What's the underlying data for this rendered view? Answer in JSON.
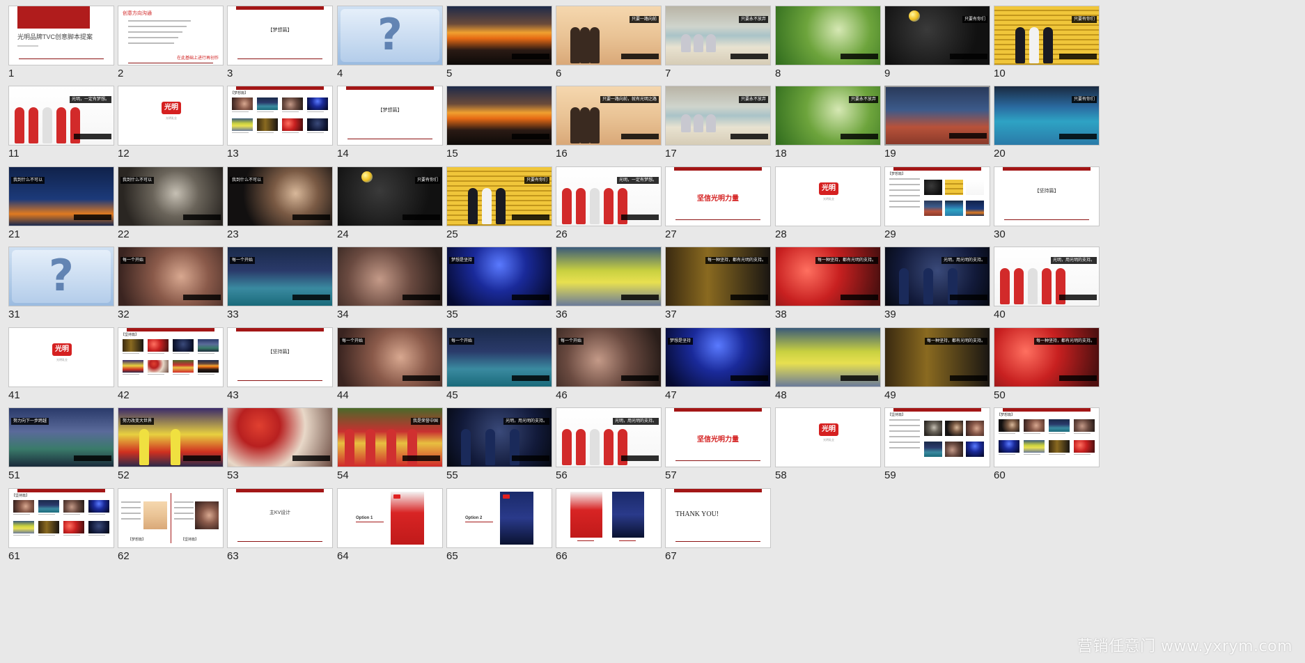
{
  "watermark": "营销任意门 www.yxrym.com",
  "colors": {
    "brand_red": "#d52020",
    "dark_red": "#a31616",
    "background": "#e8e8e8"
  },
  "slides": [
    {
      "num": "1",
      "kind": "title",
      "title": "光明品牌TVC创意脚本提案"
    },
    {
      "num": "2",
      "kind": "text-list",
      "heading": "创意方向沟通",
      "footer": "在此基础上进行再创作"
    },
    {
      "num": "3",
      "kind": "section",
      "label": "【梦想篇】"
    },
    {
      "num": "4",
      "kind": "video-missing"
    },
    {
      "num": "5",
      "kind": "photo",
      "scene": "sunset"
    },
    {
      "num": "6",
      "kind": "photo",
      "scene": "silhouettes",
      "cap_top": "只要一路向前"
    },
    {
      "num": "7",
      "kind": "photo",
      "scene": "beach",
      "cap_top": "只要永不放弃"
    },
    {
      "num": "8",
      "kind": "photo",
      "scene": "runner"
    },
    {
      "num": "9",
      "kind": "photo",
      "scene": "volleyball",
      "cap_top": "只要有你们"
    },
    {
      "num": "10",
      "kind": "photo",
      "scene": "stadium",
      "cap_top": "只要有你们"
    },
    {
      "num": "11",
      "kind": "photo",
      "scene": "team",
      "cap_top": "光明，一定有梦想。"
    },
    {
      "num": "12",
      "kind": "logo",
      "logo": "光明",
      "sub": "光明乳业"
    },
    {
      "num": "13",
      "kind": "storyboard",
      "label": "【梦想篇】"
    },
    {
      "num": "14",
      "kind": "section",
      "label": "【梦想篇】"
    },
    {
      "num": "15",
      "kind": "photo",
      "scene": "sunset"
    },
    {
      "num": "16",
      "kind": "photo",
      "scene": "silhouettes",
      "cap_top": "只要一路向前，就有光明之路"
    },
    {
      "num": "17",
      "kind": "photo",
      "scene": "beach",
      "cap_top": "只要永不放弃"
    },
    {
      "num": "18",
      "kind": "photo",
      "scene": "runner",
      "cap_top": "只要永不放弃"
    },
    {
      "num": "19",
      "kind": "photo",
      "scene": "track",
      "selected": true
    },
    {
      "num": "20",
      "kind": "photo",
      "scene": "court",
      "cap_top": "只要有你们"
    },
    {
      "num": "21",
      "kind": "photo",
      "scene": "training",
      "cap_top": "我到什么不可以"
    },
    {
      "num": "22",
      "kind": "photo",
      "scene": "dark",
      "cap_top": "我到什么不可以"
    },
    {
      "num": "23",
      "kind": "photo",
      "scene": "portrait",
      "cap_top": "我到什么不可以"
    },
    {
      "num": "24",
      "kind": "photo",
      "scene": "volleyball",
      "cap_top": "只要有你们"
    },
    {
      "num": "25",
      "kind": "photo",
      "scene": "stadium",
      "cap_top": "只要有你们"
    },
    {
      "num": "26",
      "kind": "photo",
      "scene": "team",
      "cap_top": "光明，一定有梦想。"
    },
    {
      "num": "27",
      "kind": "redtitle",
      "title": "坚信光明力量"
    },
    {
      "num": "28",
      "kind": "logo",
      "logo": "光明",
      "sub": "光明乳业"
    },
    {
      "num": "29",
      "kind": "storyboard2",
      "label": "【梦想篇】"
    },
    {
      "num": "30",
      "kind": "section",
      "label": "【坚持篇】"
    },
    {
      "num": "31",
      "kind": "video-missing"
    },
    {
      "num": "32",
      "kind": "photo",
      "scene": "player-face",
      "cap_top": "每一个开始"
    },
    {
      "num": "33",
      "kind": "photo",
      "scene": "gym",
      "cap_top": "每一个开始"
    },
    {
      "num": "34",
      "kind": "photo",
      "scene": "sweat"
    },
    {
      "num": "35",
      "kind": "photo",
      "scene": "stage",
      "cap_top": "梦想是坚持"
    },
    {
      "num": "36",
      "kind": "photo",
      "scene": "dive"
    },
    {
      "num": "37",
      "kind": "photo",
      "scene": "vocal",
      "cap_top": "每一种坚持，都有光明的支持。"
    },
    {
      "num": "38",
      "kind": "photo",
      "scene": "lights",
      "cap_top": "每一种坚持，都有光明的支持。"
    },
    {
      "num": "39",
      "kind": "photo",
      "scene": "suits",
      "cap_top": "光明，用光明的支持。"
    },
    {
      "num": "40",
      "kind": "photo",
      "scene": "team",
      "cap_top": "光明，用光明的支持。"
    },
    {
      "num": "41",
      "kind": "logo",
      "logo": "光明",
      "sub": "光明乳业"
    },
    {
      "num": "42",
      "kind": "storyboard",
      "label": "【坚持篇】"
    },
    {
      "num": "43",
      "kind": "section",
      "label": "【坚持篇】"
    },
    {
      "num": "44",
      "kind": "photo",
      "scene": "player-face",
      "cap_top": "每一个开始"
    },
    {
      "num": "45",
      "kind": "photo",
      "scene": "gym",
      "cap_top": "每一个开始"
    },
    {
      "num": "46",
      "kind": "photo",
      "scene": "sweat",
      "cap_top": "每一个开始"
    },
    {
      "num": "47",
      "kind": "photo",
      "scene": "stage",
      "cap_top": "梦想是坚持"
    },
    {
      "num": "48",
      "kind": "photo",
      "scene": "dive"
    },
    {
      "num": "49",
      "kind": "photo",
      "scene": "vocal",
      "cap_top": "每一种坚持，都有光明的支持。"
    },
    {
      "num": "50",
      "kind": "photo",
      "scene": "lights",
      "cap_top": "每一种坚持，都有光明的支持。"
    },
    {
      "num": "51",
      "kind": "photo",
      "scene": "injury",
      "cap_top": "努力向下一步跨越"
    },
    {
      "num": "52",
      "kind": "photo",
      "scene": "celebrate",
      "cap_top": "努力改变大世界"
    },
    {
      "num": "53",
      "kind": "photo",
      "scene": "flag"
    },
    {
      "num": "54",
      "kind": "photo",
      "scene": "teamcourt",
      "cap_top": "我是荣誉中国"
    },
    {
      "num": "55",
      "kind": "photo",
      "scene": "suits",
      "cap_top": "光明，用光明的支持。"
    },
    {
      "num": "56",
      "kind": "photo",
      "scene": "team",
      "cap_top": "光明，用光明的支持。"
    },
    {
      "num": "57",
      "kind": "redtitle",
      "title": "坚信光明力量"
    },
    {
      "num": "58",
      "kind": "logo",
      "logo": "光明",
      "sub": "光明乳业"
    },
    {
      "num": "59",
      "kind": "storyboard2",
      "label": "【坚持篇】"
    },
    {
      "num": "60",
      "kind": "storyboard",
      "label": "【梦想篇】"
    },
    {
      "num": "61",
      "kind": "storyboard",
      "label": "【坚持篇】"
    },
    {
      "num": "62",
      "kind": "split",
      "left": "【梦想篇】",
      "right": "【坚持篇】"
    },
    {
      "num": "63",
      "kind": "section",
      "label": "主KV设计"
    },
    {
      "num": "64",
      "kind": "option",
      "label": "Option 1"
    },
    {
      "num": "65",
      "kind": "option",
      "label": "Option 2"
    },
    {
      "num": "66",
      "kind": "option2"
    },
    {
      "num": "67",
      "kind": "thanks",
      "title": "THANK YOU!"
    }
  ]
}
